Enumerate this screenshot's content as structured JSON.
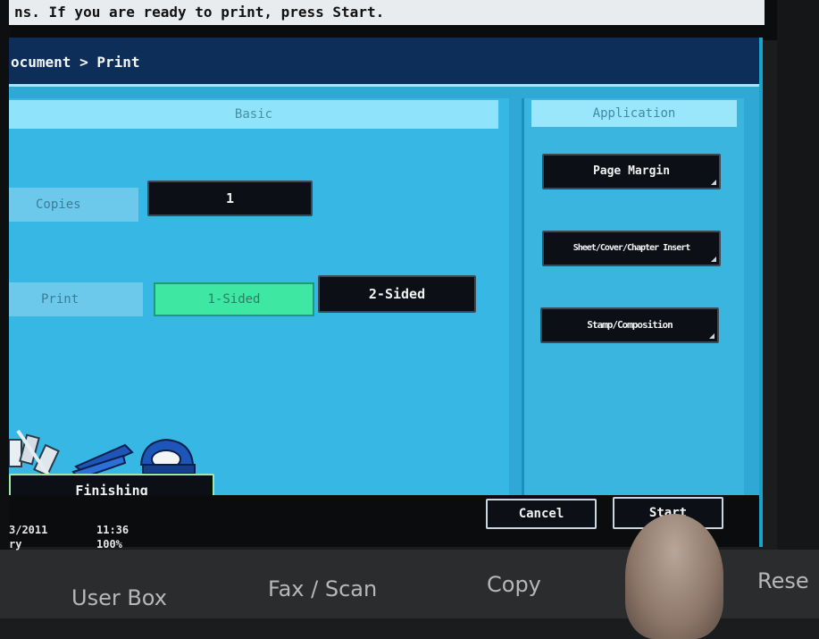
{
  "instruction": "ns. If you are ready to print, press Start.",
  "breadcrumb": "ocument > Print",
  "basic": {
    "header": "Basic",
    "copies_label": "Copies",
    "copies_value": "1",
    "print_label": "Print",
    "print_options": [
      "1-Sided",
      "2-Sided"
    ],
    "finishing_label": "Finishing"
  },
  "application": {
    "header": "Application",
    "buttons": [
      "Page Margin",
      "Sheet/Cover/Chapter Insert",
      "Stamp/Composition"
    ]
  },
  "actions": {
    "cancel": "Cancel",
    "start": "Start"
  },
  "status": {
    "date": "3/2011",
    "time": "11:36",
    "memory_label": "ry",
    "memory_value": "100%"
  },
  "hardware_buttons": [
    "User Box",
    "Fax / Scan",
    "Copy",
    "Rese"
  ],
  "colors": {
    "screen_bg": "#2fa8d6",
    "title_bar": "#0e2e5a",
    "selected_toggle": "#3ee7a2",
    "dark_button": "#0c1016"
  },
  "icons": [
    "paper-stack-icon",
    "stapler-icon",
    "hole-punch-icon"
  ]
}
